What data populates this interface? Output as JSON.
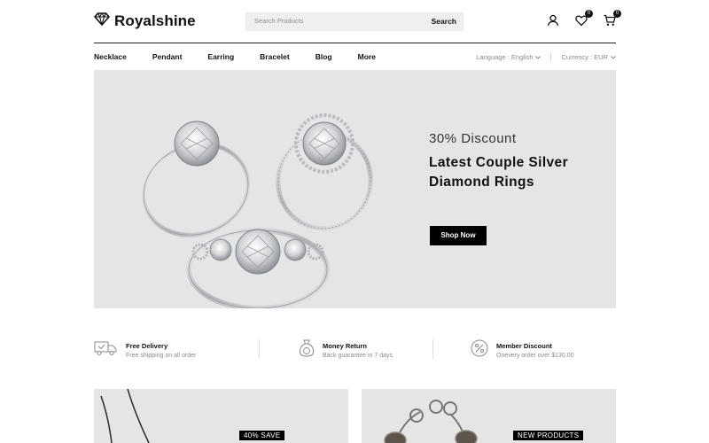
{
  "brand": {
    "name": "Royalshine",
    "icon": "diamond-icon"
  },
  "search": {
    "placeholder": "Search Products",
    "button_label": "Search"
  },
  "header_icons": {
    "account": {
      "icon": "user-icon"
    },
    "wishlist": {
      "icon": "heart-icon",
      "count": "0"
    },
    "cart": {
      "icon": "cart-icon",
      "count": "0"
    }
  },
  "nav": {
    "items": [
      "Necklace",
      "Pendant",
      "Earring",
      "Bracelet",
      "Blog",
      "More"
    ]
  },
  "prefs": {
    "language": "Language : English",
    "currency": "Currency : EUR"
  },
  "hero": {
    "discount": "30% Discount",
    "title_line1": "Latest Couple Silver",
    "title_line2": "Diamond Rings",
    "button_label": "Shop Now"
  },
  "features": [
    {
      "icon": "truck-icon",
      "title": "Free Delivery",
      "subtitle": "Free shipping on all order"
    },
    {
      "icon": "money-bag-icon",
      "title": "Money Return",
      "subtitle": "Back guarantee in 7 days"
    },
    {
      "icon": "percent-icon",
      "title": "Member Discount",
      "subtitle": "Onevery order over $130.00"
    }
  ],
  "promos": [
    {
      "tag": "40% SAVE"
    },
    {
      "tag": "NEW PRODUCTS"
    }
  ],
  "colors": {
    "accent": "#000000",
    "hero_bg": "#e5e5e5",
    "muted_text": "#8a8a8a"
  }
}
